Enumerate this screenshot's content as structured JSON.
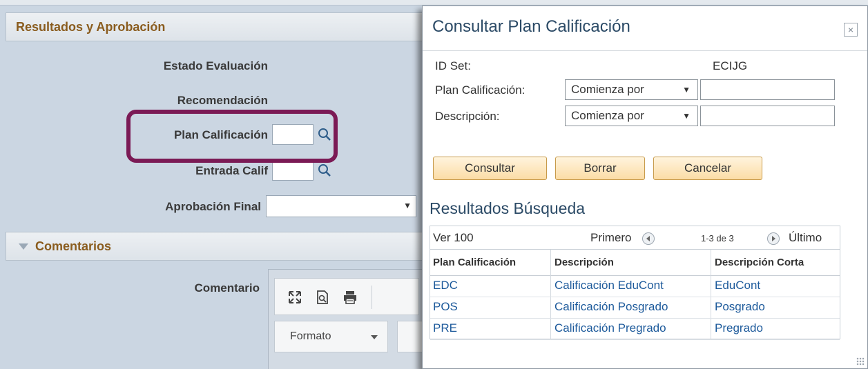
{
  "background": {
    "section_results": {
      "title": "Resultados y Aprobación"
    },
    "fields": {
      "estado_evaluacion": "Estado Evaluación",
      "recomendacion": "Recomendación",
      "plan_calificacion": "Plan Calificación",
      "entrada_calif": "Entrada Calif",
      "aprobacion_final": "Aprobación Final"
    },
    "section_comments": {
      "title": "Comentarios"
    },
    "comentario_label": "Comentario",
    "editor": {
      "format_label": "Formato"
    },
    "icons": [
      "lookup-icon",
      "maximize-icon",
      "preview-icon",
      "print-icon"
    ]
  },
  "modal": {
    "title": "Consultar Plan Calificación",
    "close_glyph": "×",
    "id_set_label": "ID Set:",
    "id_set_value": "ECIJG",
    "plan_label": "Plan Calificación:",
    "plan_operator": "Comienza por",
    "desc_label": "Descripción:",
    "desc_operator": "Comienza por",
    "plan_value": "",
    "desc_value": "",
    "buttons": {
      "consultar": "Consultar",
      "borrar": "Borrar",
      "cancelar": "Cancelar"
    },
    "results_title": "Resultados Búsqueda",
    "nav": {
      "view": "Ver 100",
      "first": "Primero",
      "count": "1-3 de 3",
      "last": "Último"
    },
    "columns": [
      "Plan Calificación",
      "Descripción",
      "Descripción Corta"
    ],
    "rows": [
      {
        "plan": "EDC",
        "desc": "Calificación EduCont",
        "short": "EduCont"
      },
      {
        "plan": "POS",
        "desc": "Calificación Posgrado",
        "short": "Posgrado"
      },
      {
        "plan": "PRE",
        "desc": "Calificación Pregrado",
        "short": "Pregrado"
      }
    ]
  },
  "colors": {
    "section_title": "#8a5c1e",
    "highlight_border": "#7b1a55",
    "link": "#1d5a9b",
    "button_bg": "#fbdca6"
  }
}
